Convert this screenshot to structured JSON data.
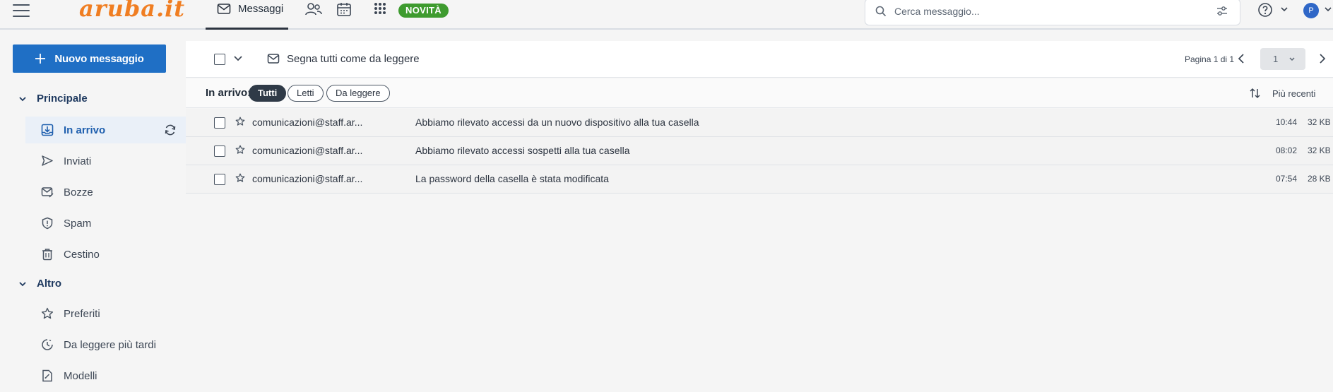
{
  "brand": {
    "logo_text": "aruba.it",
    "logo_color": "#f07e22"
  },
  "topnav": {
    "messages_label": "Messaggi",
    "novita_label": "NOVITÀ",
    "icons": [
      "mail-icon",
      "contacts-icon",
      "calendar-icon",
      "apps-grid-icon"
    ]
  },
  "search": {
    "placeholder": "Cerca messaggio..."
  },
  "user": {
    "avatar_initial": "P",
    "avatar_color": "#2f67c7"
  },
  "sidebar": {
    "new_message_label": "Nuovo messaggio",
    "sections": [
      {
        "title": "Principale",
        "items": [
          {
            "label": "In arrivo",
            "icon": "inbox-icon",
            "active": true
          },
          {
            "label": "Inviati",
            "icon": "send-icon"
          },
          {
            "label": "Bozze",
            "icon": "draft-icon"
          },
          {
            "label": "Spam",
            "icon": "shield-icon"
          },
          {
            "label": "Cestino",
            "icon": "trash-icon"
          }
        ]
      },
      {
        "title": "Altro",
        "items": [
          {
            "label": "Preferiti",
            "icon": "star-icon"
          },
          {
            "label": "Da leggere più tardi",
            "icon": "clock-icon"
          },
          {
            "label": "Modelli",
            "icon": "template-icon"
          }
        ]
      }
    ]
  },
  "toolbar": {
    "mark_all_read_label": "Segna tutti come da leggere",
    "pagination_text": "Pagina 1 di 1",
    "page_select_value": "1"
  },
  "filters": {
    "label": "In arrivo:",
    "chips": [
      "Tutti",
      "Letti",
      "Da leggere"
    ],
    "active_chip": "Tutti",
    "sort_label": "Più recenti"
  },
  "messages": [
    {
      "sender": "comunicazioni@staff.ar...",
      "subject": "Abbiamo rilevato accessi da un nuovo dispositivo alla tua casella",
      "time": "10:44",
      "size": "32 KB"
    },
    {
      "sender": "comunicazioni@staff.ar...",
      "subject": "Abbiamo rilevato accessi sospetti alla tua casella",
      "time": "08:02",
      "size": "32 KB"
    },
    {
      "sender": "comunicazioni@staff.ar...",
      "subject": "La password della casella è stata modificata",
      "time": "07:54",
      "size": "28 KB"
    }
  ],
  "colors": {
    "primary": "#1f6fc5",
    "novita_badge": "#3e9b2f",
    "active_chip": "#2f3a47"
  }
}
